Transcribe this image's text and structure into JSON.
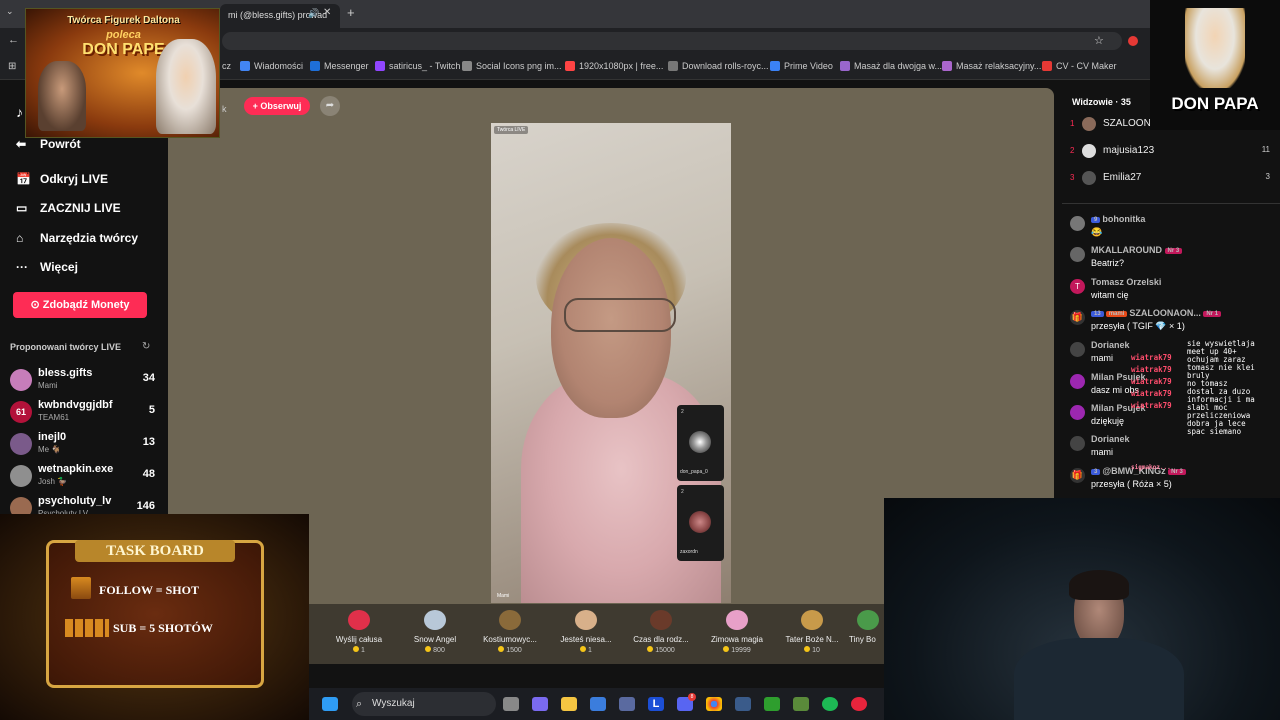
{
  "browser": {
    "tab_title": "mi (@bless.gifts) prowad",
    "bookmarks": [
      "cz",
      "Wiadomości",
      "Messenger",
      "satiricus_ - Twitch",
      "Social Icons png im...",
      "1920x1080px | free...",
      "Download rolls-royc...",
      "Prime Video",
      "Masaż dla dwojga w...",
      "Masaż relaksacyjny...",
      "CV - CV Maker"
    ],
    "bookmark_colors": [
      "#4285f4",
      "#1e6fd9",
      "#9146ff",
      "#888888",
      "#ff4444",
      "#777777",
      "#3b82f6",
      "#9966cc",
      "#aa66cc",
      "#e53935"
    ]
  },
  "sidebar": {
    "back_label": "Powrót",
    "nav": [
      {
        "icon": "calendar-icon",
        "label": "Odkryj LIVE"
      },
      {
        "icon": "camera-icon",
        "label": "ZACZNIJ LIVE"
      },
      {
        "icon": "home-icon",
        "label": "Narzędzia twórcy"
      },
      {
        "icon": "more-icon",
        "label": "Więcej"
      }
    ],
    "coins_button": "Zdobądź Monety",
    "suggested_title": "Proponowani twórcy LIVE",
    "creators": [
      {
        "name": "bless.gifts",
        "sub": "Mami",
        "count": "34",
        "color": "#c77dba"
      },
      {
        "name": "kwbndvggjdbf",
        "sub": "TEAM61",
        "count": "5",
        "color": "#b3123a",
        "badge": "61"
      },
      {
        "name": "inejl0",
        "sub": "Me 🐐",
        "count": "13",
        "color": "#7a5a8a"
      },
      {
        "name": "wetnapkin.exe",
        "sub": "Josh 🦆",
        "count": "48",
        "color": "#8f8f8f"
      },
      {
        "name": "psycholuty_lv",
        "sub": "Psycholuty LV",
        "count": "146",
        "color": "#9a6a50"
      }
    ]
  },
  "stage": {
    "follow_button": "+ Obserwuj",
    "partial_name": "k",
    "video_label": "Twórca LIVE",
    "host_label": "Mami",
    "guests": [
      {
        "name": "don_papa_0",
        "count": "2"
      },
      {
        "name": "zaxordn",
        "count": "2"
      }
    ]
  },
  "gifts": [
    {
      "name": "Wyślij całusa",
      "price": "1",
      "color": "#e0304a"
    },
    {
      "name": "Snow Angel",
      "price": "800",
      "color": "#b8c8d8"
    },
    {
      "name": "Kostiumowyc...",
      "price": "1500",
      "color": "#8a6a3a"
    },
    {
      "name": "Jesteś niesa...",
      "price": "1",
      "color": "#d8b08a"
    },
    {
      "name": "Czas dla rodz...",
      "price": "15000",
      "color": "#6a3a2a"
    },
    {
      "name": "Zimowa magia",
      "price": "19999",
      "color": "#e8a0c8"
    },
    {
      "name": "Tater Boże N...",
      "price": "10",
      "color": "#c89a4a"
    },
    {
      "name": "Tiny Bo",
      "price": "",
      "color": "#4a9a4a"
    }
  ],
  "viewers": {
    "title": "Widzowie · 35",
    "list": [
      {
        "rank": "1",
        "name": "SZALOON",
        "count": "",
        "color": "#8a6a5a"
      },
      {
        "rank": "2",
        "name": "majusia123",
        "count": "11",
        "color": "#dddddd"
      },
      {
        "rank": "3",
        "name": "Emilia27",
        "count": "3",
        "color": "#555555"
      }
    ]
  },
  "chat": [
    {
      "user": "bohonitka",
      "badge": "9",
      "text": "😂",
      "color": "#777"
    },
    {
      "user": "MKALLAROUND",
      "badge": "Nr 3",
      "text": "Beatriz?",
      "color": "#666"
    },
    {
      "user": "Tomasz Orzelski",
      "badge": "",
      "text": "witam cię",
      "color": "#c2185b",
      "letter": "T"
    },
    {
      "user": "SZALOONAON...",
      "badge": "13",
      "text": "przesyła ( TGIF 💎 × 1)",
      "color": "#333",
      "gift": true,
      "extra": "mami",
      "rank": "Nr 1"
    },
    {
      "user": "Dorianek",
      "badge": "",
      "text": "mami",
      "color": "#444"
    },
    {
      "user": "Milan Psujek",
      "badge": "",
      "text": "dasz mi obs",
      "color": "#9c27b0"
    },
    {
      "user": "Milan Psujek",
      "badge": "",
      "text": "dziękuję",
      "color": "#9c27b0"
    },
    {
      "user": "Dorianek",
      "badge": "",
      "text": "mami",
      "color": "#444"
    },
    {
      "user": "@BMW_KINGz",
      "badge": "3",
      "text": "przesyła ( Róża × 5)",
      "color": "#333",
      "gift": true,
      "rank": "Nr 3"
    }
  ],
  "overlay_chat": {
    "lines": [
      "sie wyswietlaja",
      "meet up 40+",
      "ochujam zaraz",
      "tomasz nie klei",
      "bruly",
      "no tomasz",
      "dostal za duzo",
      "informacji i ma",
      "slabl moc",
      "przeliczeniowa",
      "dobra ja lece",
      "spac siemano"
    ],
    "names": [
      "wiatrak79",
      "wiatrak79",
      "wiatrak79",
      "wiatrak79",
      "wiatrak79",
      "sigmakoz..."
    ]
  },
  "top_banner": {
    "line1": "Twórca Figurek Daltona",
    "line2": "poleca",
    "line3": "DON PAPE"
  },
  "logo": {
    "text": "DON PAPA"
  },
  "taskboard": {
    "title": "TASK BOARD",
    "item1": "FOLLOW = SHOT",
    "item2": "SUB = 5 SHOTÓW"
  },
  "taskbar": {
    "search_placeholder": "Wyszukaj",
    "icons": [
      "windows-icon",
      "weather-icon",
      "taskview-icon",
      "copilot-icon",
      "folder-icon",
      "store-icon",
      "vpn-icon",
      "launcher-icon",
      "discord-icon",
      "chrome-icon",
      "steam-icon",
      "xbox-icon",
      "minecraft-icon",
      "spotify-icon",
      "opera-icon"
    ],
    "icon_colors": [
      "#2f9cf4",
      "#3a8fd8",
      "#888888",
      "#7a6af0",
      "#f5c542",
      "#3b7ddd",
      "#5a6aa0",
      "#1c4fd6",
      "#5865f2",
      "#f2b632",
      "#3a5b8a",
      "#2e9e2e",
      "#5a8a3a",
      "#1db954",
      "#e8243c"
    ],
    "discord_badge": "8"
  }
}
